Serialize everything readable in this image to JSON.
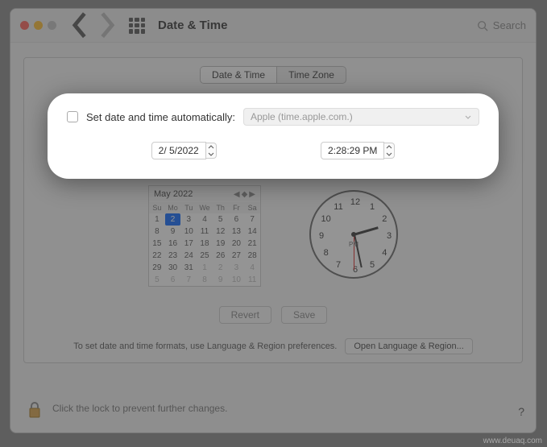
{
  "titlebar": {
    "title": "Date & Time",
    "search_placeholder": "Search"
  },
  "tabs": {
    "selected": "Date & Time",
    "other": "Time Zone"
  },
  "auto": {
    "label": "Set date and time automatically:",
    "server": "Apple (time.apple.com.)"
  },
  "date_field": "2/  5/2022",
  "time_field": "2:28:29 PM",
  "calendar": {
    "title": "May 2022",
    "dow": [
      "Su",
      "Mo",
      "Tu",
      "We",
      "Th",
      "Fr",
      "Sa"
    ],
    "weeks": [
      [
        {
          "d": 1
        },
        {
          "d": 2,
          "sel": true
        },
        {
          "d": 3
        },
        {
          "d": 4
        },
        {
          "d": 5
        },
        {
          "d": 6
        },
        {
          "d": 7
        }
      ],
      [
        {
          "d": 8
        },
        {
          "d": 9
        },
        {
          "d": 10
        },
        {
          "d": 11
        },
        {
          "d": 12
        },
        {
          "d": 13
        },
        {
          "d": 14
        }
      ],
      [
        {
          "d": 15
        },
        {
          "d": 16
        },
        {
          "d": 17
        },
        {
          "d": 18
        },
        {
          "d": 19
        },
        {
          "d": 20
        },
        {
          "d": 21
        }
      ],
      [
        {
          "d": 22
        },
        {
          "d": 23
        },
        {
          "d": 24
        },
        {
          "d": 25
        },
        {
          "d": 26
        },
        {
          "d": 27
        },
        {
          "d": 28
        }
      ],
      [
        {
          "d": 29
        },
        {
          "d": 30
        },
        {
          "d": 31
        },
        {
          "d": 1,
          "gray": true
        },
        {
          "d": 2,
          "gray": true
        },
        {
          "d": 3,
          "gray": true
        },
        {
          "d": 4,
          "gray": true
        }
      ],
      [
        {
          "d": 5,
          "gray": true
        },
        {
          "d": 6,
          "gray": true
        },
        {
          "d": 7,
          "gray": true
        },
        {
          "d": 8,
          "gray": true
        },
        {
          "d": 9,
          "gray": true
        },
        {
          "d": 10,
          "gray": true
        },
        {
          "d": 11,
          "gray": true
        }
      ]
    ]
  },
  "clock": {
    "ampm": "PM",
    "numbers": [
      "12",
      "1",
      "2",
      "3",
      "4",
      "5",
      "6",
      "7",
      "8",
      "9",
      "10",
      "11"
    ]
  },
  "buttons": {
    "revert": "Revert",
    "save": "Save"
  },
  "footer": {
    "hint": "To set date and time formats, use Language & Region preferences.",
    "open": "Open Language & Region..."
  },
  "lock": {
    "text": "Click the lock to prevent further changes."
  },
  "help": "?",
  "watermark": "www.deuaq.com"
}
